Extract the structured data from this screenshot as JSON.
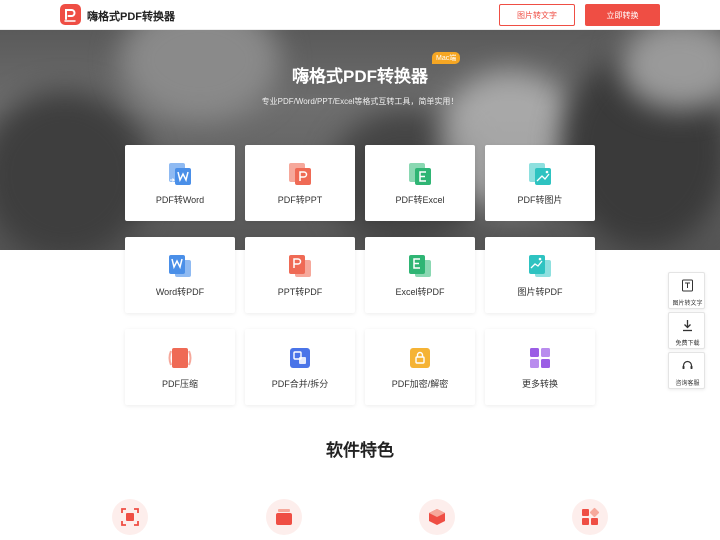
{
  "header": {
    "brand": "嗨格式PDF转换器",
    "btn_image_to_text": "图片转文字",
    "btn_convert_now": "立即转换"
  },
  "hero": {
    "title": "嗨格式PDF转换器",
    "badge": "Mac端",
    "subtitle": "专业PDF/Word/PPT/Excel等格式互转工具，简单实用！"
  },
  "tools": [
    {
      "label": "PDF转Word",
      "icon": "pdf-to-word-icon"
    },
    {
      "label": "PDF转PPT",
      "icon": "pdf-to-ppt-icon"
    },
    {
      "label": "PDF转Excel",
      "icon": "pdf-to-excel-icon"
    },
    {
      "label": "PDF转图片",
      "icon": "pdf-to-image-icon"
    },
    {
      "label": "Word转PDF",
      "icon": "word-to-pdf-icon"
    },
    {
      "label": "PPT转PDF",
      "icon": "ppt-to-pdf-icon"
    },
    {
      "label": "Excel转PDF",
      "icon": "excel-to-pdf-icon"
    },
    {
      "label": "图片转PDF",
      "icon": "image-to-pdf-icon"
    },
    {
      "label": "PDF压缩",
      "icon": "pdf-compress-icon"
    },
    {
      "label": "PDF合并/拆分",
      "icon": "pdf-merge-split-icon"
    },
    {
      "label": "PDF加密/解密",
      "icon": "pdf-lock-icon"
    },
    {
      "label": "更多转换",
      "icon": "more-grid-icon"
    }
  ],
  "side": {
    "image_to_text": "图片转文字",
    "download": "免费下载",
    "support": "咨询客服"
  },
  "features": {
    "title": "软件特色"
  },
  "colors": {
    "accent": "#ef4e44",
    "word": "#4a8fe8",
    "ppt": "#ef6a55",
    "excel": "#2fb574",
    "image": "#2ec3c1",
    "merge": "#4a74e8",
    "lock": "#f5b335",
    "more": "#9b5de5"
  }
}
